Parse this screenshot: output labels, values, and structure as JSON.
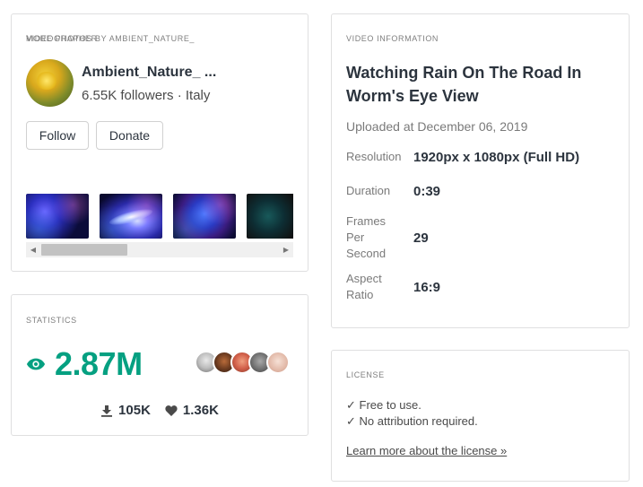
{
  "videographer": {
    "section_label": "VIDEOGRAPHER",
    "name": "Ambient_Nature_ ...",
    "meta": "6.55K followers · Italy",
    "follow_label": "Follow",
    "donate_label": "Donate",
    "more_label": "MORE PHOTOS BY AMBIENT_NATURE_",
    "thumbnails": [
      "nebula-thumbnail",
      "galaxy-thumbnail",
      "nebula-thumbnail",
      "space-thumbnail"
    ]
  },
  "statistics": {
    "section_label": "STATISTICS",
    "views": "2.87M",
    "downloads": "105K",
    "likes": "1.36K",
    "accent_color": "#05a081"
  },
  "video_info": {
    "section_label": "VIDEO INFORMATION",
    "title": "Watching Rain On The Road In Worm's Eye View",
    "uploaded": "Uploaded at December 06, 2019",
    "rows": [
      {
        "key": "Resolution",
        "value": "1920px x 1080px (Full HD)"
      },
      {
        "key": "Duration",
        "value": "0:39"
      },
      {
        "key": "Frames Per Second",
        "value": "29"
      },
      {
        "key": "Aspect Ratio",
        "value": "16:9"
      }
    ]
  },
  "license": {
    "section_label": "LICENSE",
    "line1": "✓ Free to use.",
    "line2": "✓ No attribution required.",
    "link": "Learn more about the license »"
  }
}
